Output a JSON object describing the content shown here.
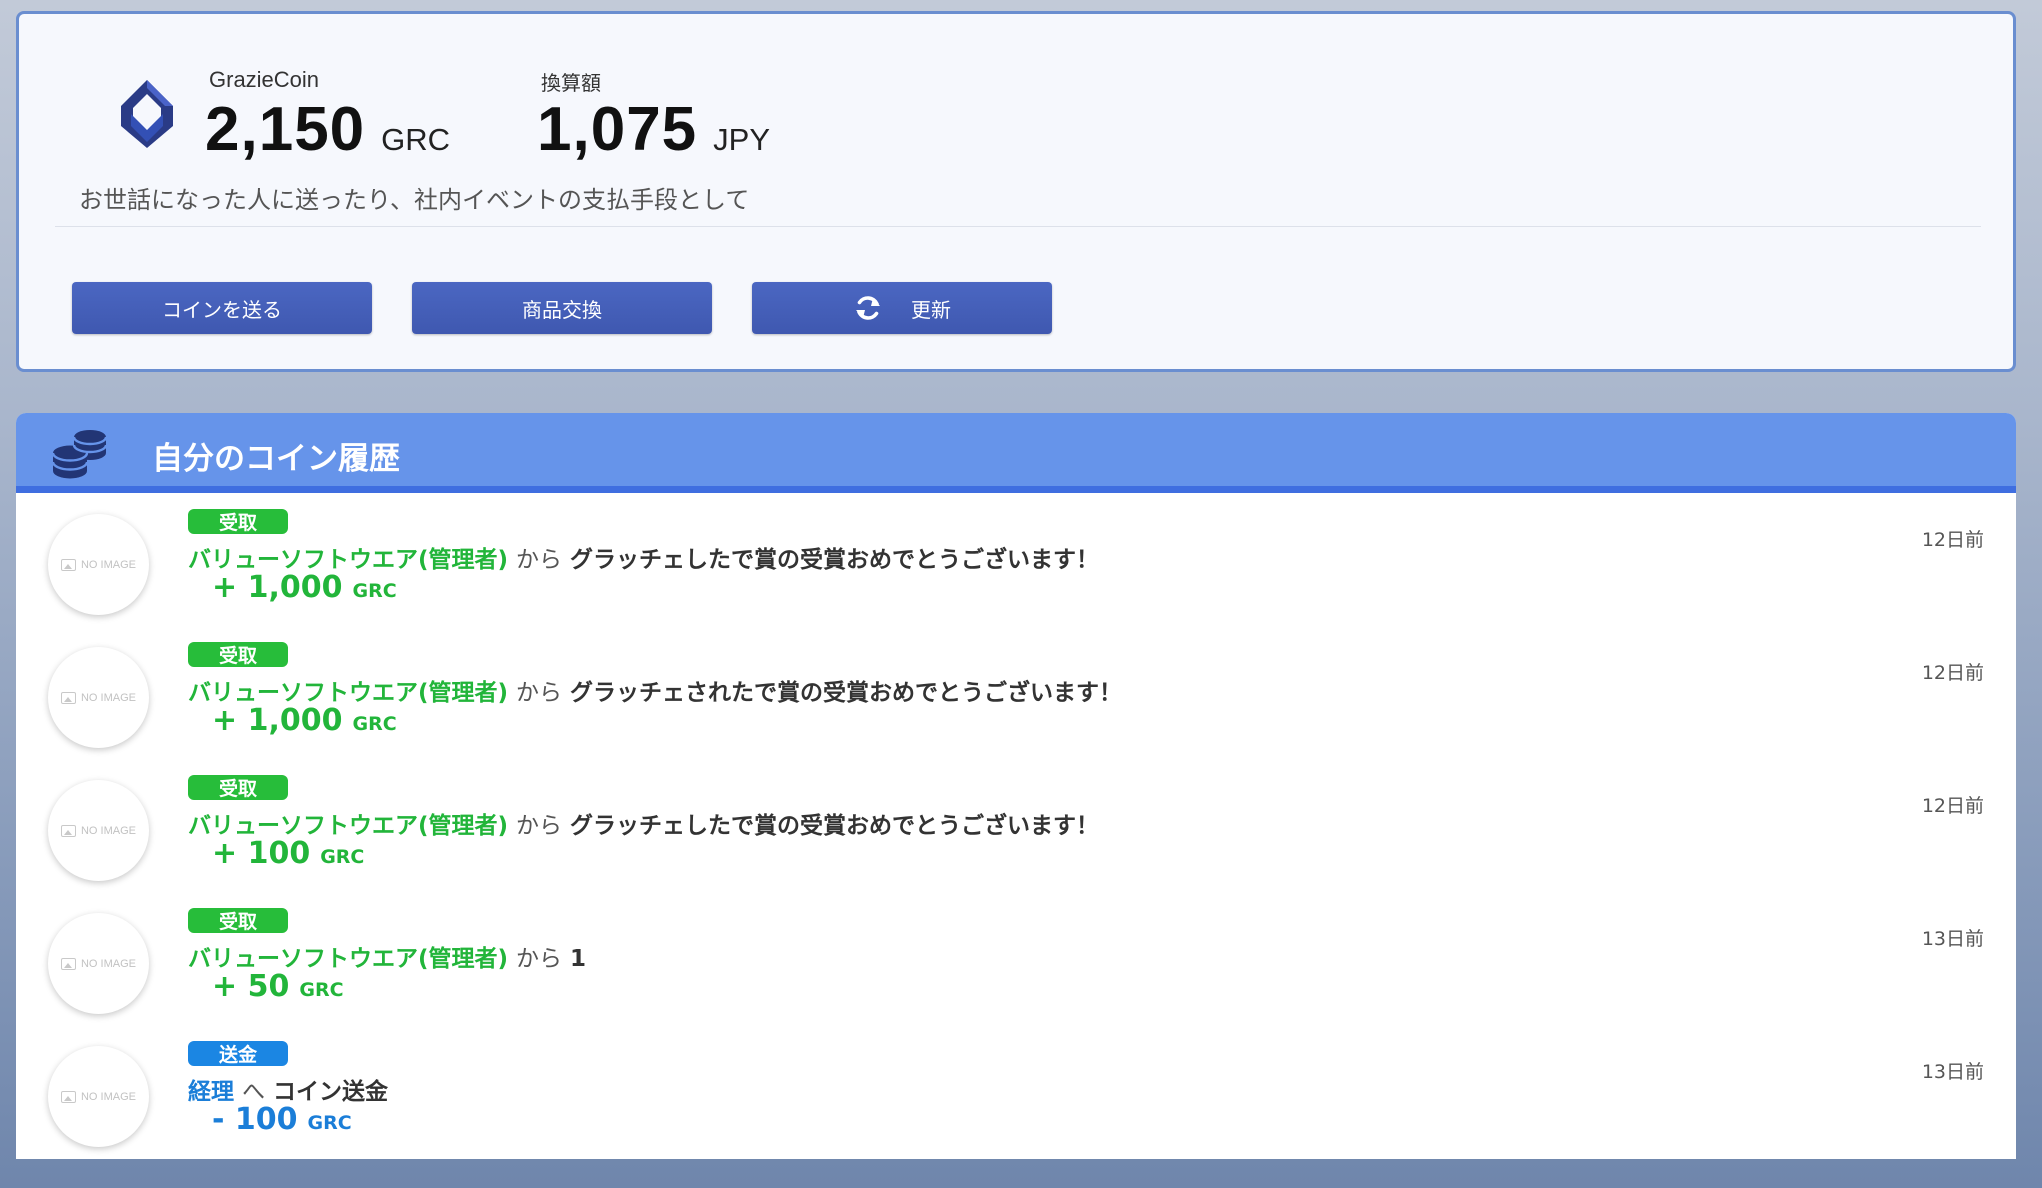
{
  "wallet": {
    "coin_name": "GrazieCoin",
    "balance": "2,150",
    "balance_unit": "GRC",
    "conversion_label": "換算額",
    "conversion_value": "1,075",
    "conversion_unit": "JPY",
    "tagline": "お世話になった人に送ったり、社内イベントの支払手段として",
    "logo_icon": "graziecoin-logo-icon"
  },
  "actions": {
    "send_coin": "コインを送る",
    "exchange": "商品交換",
    "refresh": "更新",
    "refresh_icon": "refresh-icon"
  },
  "history": {
    "title": "自分のコイン履歴",
    "icon": "coins-stack-icon",
    "no_image_text": "NO IMAGE",
    "items": [
      {
        "type": "recv",
        "badge": "受取",
        "partner": "バリューソフトウエア(管理者)",
        "direction": "から",
        "message": "グラッチェしたで賞の受賞おめでとうございます！",
        "amount": "+ 1,000",
        "unit": "GRC",
        "time": "12日前"
      },
      {
        "type": "recv",
        "badge": "受取",
        "partner": "バリューソフトウエア(管理者)",
        "direction": "から",
        "message": "グラッチェされたで賞の受賞おめでとうございます！",
        "amount": "+ 1,000",
        "unit": "GRC",
        "time": "12日前"
      },
      {
        "type": "recv",
        "badge": "受取",
        "partner": "バリューソフトウエア(管理者)",
        "direction": "から",
        "message": "グラッチェしたで賞の受賞おめでとうございます！",
        "amount": "+ 100",
        "unit": "GRC",
        "time": "12日前"
      },
      {
        "type": "recv",
        "badge": "受取",
        "partner": "バリューソフトウエア(管理者)",
        "direction": "から",
        "message": "1",
        "amount": "+ 50",
        "unit": "GRC",
        "time": "13日前"
      },
      {
        "type": "send",
        "badge": "送金",
        "partner": "経理",
        "direction": "へ",
        "message": "コイン送金",
        "amount": "- 100",
        "unit": "GRC",
        "time": "13日前"
      }
    ]
  },
  "colors": {
    "primary_button": "#4460bb",
    "header_bar": "#6694ea",
    "received_green": "#22b53a",
    "sent_blue": "#1b7ed8"
  }
}
